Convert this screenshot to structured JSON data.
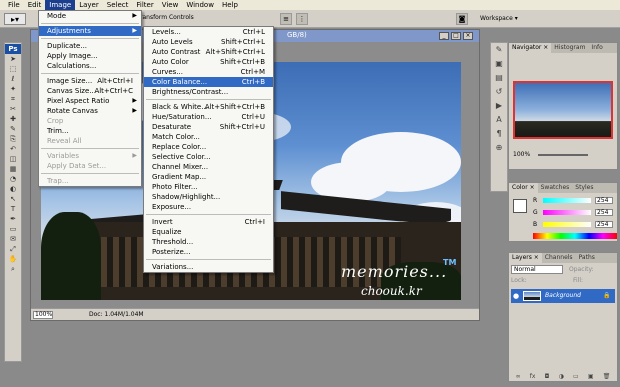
{
  "menubar": {
    "items": [
      "File",
      "Edit",
      "Image",
      "Layer",
      "Select",
      "Filter",
      "View",
      "Window",
      "Help"
    ],
    "active_index": 2
  },
  "options": {
    "transform_controls": "ransform Controls",
    "workspace_label": "Workspace ▾"
  },
  "toolbox": {
    "logo": "Ps",
    "tools": [
      "move-tool",
      "marquee-tool",
      "lasso-tool",
      "magic-wand-tool",
      "crop-tool",
      "slice-tool",
      "healing-tool",
      "brush-tool",
      "stamp-tool",
      "history-brush-tool",
      "eraser-tool",
      "gradient-tool",
      "blur-tool",
      "dodge-tool",
      "path-select-tool",
      "type-tool",
      "pen-tool",
      "shape-tool",
      "notes-tool",
      "eyedropper-tool",
      "hand-tool",
      "zoom-tool"
    ]
  },
  "document": {
    "title_fragment": "GB/8)",
    "zoom": "100%",
    "doc_size": "Doc: 1.04M/1.04M",
    "watermark_line1": "memories...",
    "watermark_line2": "choouk.kr",
    "watermark_tm": "TM"
  },
  "image_menu": {
    "items": [
      {
        "label": "Mode",
        "submenu": true
      },
      {
        "sep": true
      },
      {
        "label": "Adjustments",
        "submenu": true,
        "highlight": true
      },
      {
        "sep": true
      },
      {
        "label": "Duplicate..."
      },
      {
        "label": "Apply Image..."
      },
      {
        "label": "Calculations..."
      },
      {
        "sep": true
      },
      {
        "label": "Image Size...",
        "shortcut": "Alt+Ctrl+I"
      },
      {
        "label": "Canvas Size...",
        "shortcut": "Alt+Ctrl+C"
      },
      {
        "label": "Pixel Aspect Ratio",
        "submenu": true
      },
      {
        "label": "Rotate Canvas",
        "submenu": true
      },
      {
        "label": "Crop",
        "disabled": true
      },
      {
        "label": "Trim..."
      },
      {
        "label": "Reveal All",
        "disabled": true
      },
      {
        "sep": true
      },
      {
        "label": "Variables",
        "submenu": true,
        "disabled": true
      },
      {
        "label": "Apply Data Set...",
        "disabled": true
      },
      {
        "sep": true
      },
      {
        "label": "Trap...",
        "disabled": true
      }
    ]
  },
  "adjustments_menu": {
    "items": [
      {
        "label": "Levels...",
        "shortcut": "Ctrl+L"
      },
      {
        "label": "Auto Levels",
        "shortcut": "Shift+Ctrl+L"
      },
      {
        "label": "Auto Contrast",
        "shortcut": "Alt+Shift+Ctrl+L"
      },
      {
        "label": "Auto Color",
        "shortcut": "Shift+Ctrl+B"
      },
      {
        "label": "Curves...",
        "shortcut": "Ctrl+M"
      },
      {
        "label": "Color Balance...",
        "shortcut": "Ctrl+B",
        "highlight": true
      },
      {
        "label": "Brightness/Contrast..."
      },
      {
        "sep": true
      },
      {
        "label": "Black & White...",
        "shortcut": "Alt+Shift+Ctrl+B"
      },
      {
        "label": "Hue/Saturation...",
        "shortcut": "Ctrl+U"
      },
      {
        "label": "Desaturate",
        "shortcut": "Shift+Ctrl+U"
      },
      {
        "label": "Match Color..."
      },
      {
        "label": "Replace Color..."
      },
      {
        "label": "Selective Color..."
      },
      {
        "label": "Channel Mixer..."
      },
      {
        "label": "Gradient Map..."
      },
      {
        "label": "Photo Filter..."
      },
      {
        "label": "Shadow/Highlight..."
      },
      {
        "label": "Exposure..."
      },
      {
        "sep": true
      },
      {
        "label": "Invert",
        "shortcut": "Ctrl+I"
      },
      {
        "label": "Equalize"
      },
      {
        "label": "Threshold..."
      },
      {
        "label": "Posterize..."
      },
      {
        "sep": true
      },
      {
        "label": "Variations..."
      }
    ]
  },
  "navigator_panel": {
    "tabs": [
      "Navigator ×",
      "Histogram",
      "Info"
    ],
    "zoom": "100%"
  },
  "color_panel": {
    "tabs": [
      "Color ×",
      "Swatches",
      "Styles"
    ],
    "channels": [
      {
        "name": "R",
        "value": "254",
        "gradient": "linear-gradient(90deg,#00fefe,#fefefe)"
      },
      {
        "name": "G",
        "value": "254",
        "gradient": "linear-gradient(90deg,#fe00fe,#fefefe)"
      },
      {
        "name": "B",
        "value": "254",
        "gradient": "linear-gradient(90deg,#fefe00,#fefefe)"
      }
    ]
  },
  "layers_panel": {
    "tabs": [
      "Layers ×",
      "Channels",
      "Paths"
    ],
    "blend_mode": "Normal",
    "opacity_label": "Opacity:",
    "lock_label": "Lock:",
    "fill_label": "Fill:",
    "layer_name": "Background",
    "footer_icons": [
      "link-icon",
      "fx-icon",
      "mask-icon",
      "adjustment-icon",
      "folder-icon",
      "new-layer-icon",
      "trash-icon"
    ]
  },
  "colors": {
    "menu_highlight": "#316ac5",
    "title_bar": "#7f97c9",
    "ps_blue": "#1b4fa3"
  }
}
